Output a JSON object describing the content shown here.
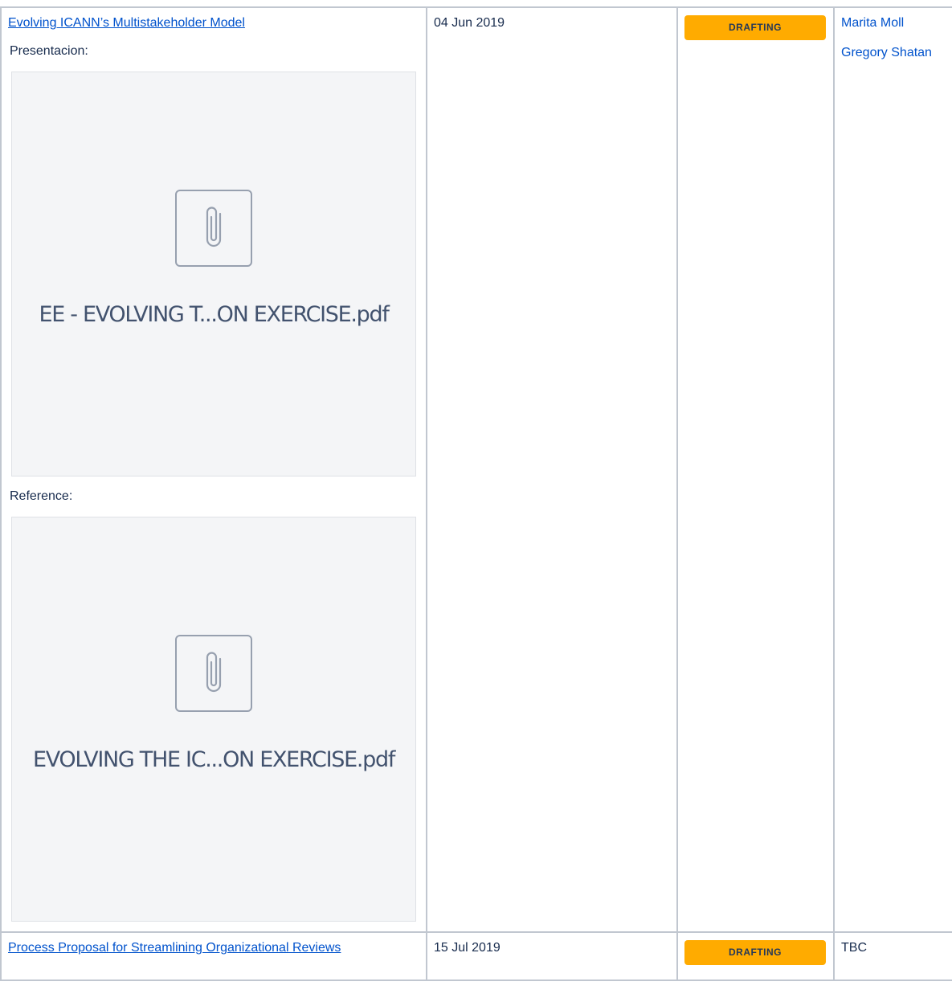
{
  "rows": [
    {
      "title": "Evolving ICANN’s Multistakeholder Model",
      "date": "04 Jun 2019",
      "status": "DRAFTING",
      "owners": [
        "Marita Moll",
        "Gregory Shatan"
      ],
      "sections": [
        {
          "label": "Presentacion:",
          "attachment": {
            "filename": "EE - EVOLVING T...ON EXERCISE.pdf",
            "icon": "paperclip-icon"
          }
        },
        {
          "label": "Reference:",
          "attachment": {
            "filename": "EVOLVING THE IC...ON EXERCISE.pdf",
            "icon": "paperclip-icon"
          }
        }
      ]
    },
    {
      "title": "Process Proposal for Streamlining Organizational Reviews",
      "date": "15 Jul 2019",
      "status": "DRAFTING",
      "owner_text": "TBC"
    }
  ],
  "colors": {
    "link": "#0052cc",
    "status_bg": "#ffab00",
    "status_text": "#253858",
    "border": "#c1c7d0",
    "attachment_bg": "#f4f5f7"
  }
}
